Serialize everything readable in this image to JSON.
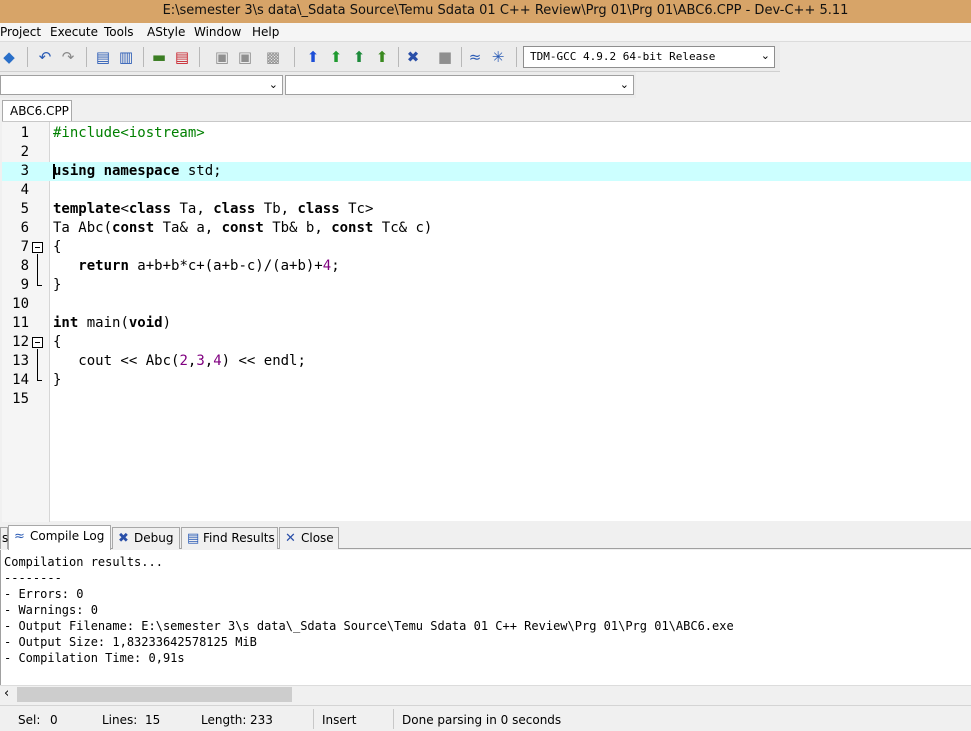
{
  "window": {
    "title": "E:\\semester 3\\s data\\_Sdata Source\\Temu Sdata 01 C++ Review\\Prg 01\\Prg 01\\ABC6.CPP - Dev-C++ 5.11"
  },
  "menu": [
    "Project",
    "Execute",
    "Tools",
    "AStyle",
    "Window",
    "Help"
  ],
  "toolbar": {
    "compiler": "TDM-GCC 4.9.2 64-bit Release",
    "icons": [
      "project-cube-icon",
      "undo-icon",
      "redo-icon",
      "bookmark-icon",
      "bookmark-goto-icon",
      "indent-icon",
      "unindent-icon",
      "add-to-project-icon",
      "remove-from-project-icon",
      "project-options-icon",
      "compile-icon",
      "run-icon",
      "compile-run-icon",
      "rebuild-icon",
      "debug-icon",
      "stop-icon",
      "syntax-check-icon",
      "profile-icon"
    ]
  },
  "editor": {
    "file_tab": "ABC6.CPP",
    "current_line": 3,
    "lines": [
      {
        "num": "1",
        "tokens": [
          {
            "t": "#include<iostream>",
            "c": "pp"
          }
        ]
      },
      {
        "num": "2",
        "tokens": []
      },
      {
        "num": "3",
        "tokens": [
          {
            "t": "using namespace",
            "c": "kw"
          },
          {
            "t": " std;",
            "c": ""
          }
        ]
      },
      {
        "num": "4",
        "tokens": []
      },
      {
        "num": "5",
        "tokens": [
          {
            "t": "template",
            "c": "kw"
          },
          {
            "t": "<",
            "c": ""
          },
          {
            "t": "class",
            "c": "kw"
          },
          {
            "t": " Ta, ",
            "c": ""
          },
          {
            "t": "class",
            "c": "kw"
          },
          {
            "t": " Tb, ",
            "c": ""
          },
          {
            "t": "class",
            "c": "kw"
          },
          {
            "t": " Tc>",
            "c": ""
          }
        ]
      },
      {
        "num": "6",
        "tokens": [
          {
            "t": "Ta Abc(",
            "c": ""
          },
          {
            "t": "const",
            "c": "kw"
          },
          {
            "t": " Ta& a, ",
            "c": ""
          },
          {
            "t": "const",
            "c": "kw"
          },
          {
            "t": " Tb& b, ",
            "c": ""
          },
          {
            "t": "const",
            "c": "kw"
          },
          {
            "t": " Tc& c)",
            "c": ""
          }
        ]
      },
      {
        "num": "7",
        "tokens": [
          {
            "t": "{",
            "c": ""
          }
        ]
      },
      {
        "num": "8",
        "tokens": [
          {
            "t": "   ",
            "c": ""
          },
          {
            "t": "return",
            "c": "kw"
          },
          {
            "t": " a+b+b*c+(a+b-c)/(a+b)+",
            "c": ""
          },
          {
            "t": "4",
            "c": "nm"
          },
          {
            "t": ";",
            "c": ""
          }
        ]
      },
      {
        "num": "9",
        "tokens": [
          {
            "t": "}",
            "c": ""
          }
        ]
      },
      {
        "num": "10",
        "tokens": []
      },
      {
        "num": "11",
        "tokens": [
          {
            "t": "int",
            "c": "kw"
          },
          {
            "t": " main(",
            "c": ""
          },
          {
            "t": "void",
            "c": "kw"
          },
          {
            "t": ")",
            "c": ""
          }
        ]
      },
      {
        "num": "12",
        "tokens": [
          {
            "t": "{",
            "c": ""
          }
        ]
      },
      {
        "num": "13",
        "tokens": [
          {
            "t": "   cout << Abc(",
            "c": ""
          },
          {
            "t": "2",
            "c": "nm"
          },
          {
            "t": ",",
            "c": ""
          },
          {
            "t": "3",
            "c": "nm"
          },
          {
            "t": ",",
            "c": ""
          },
          {
            "t": "4",
            "c": "nm"
          },
          {
            "t": ") << endl;",
            "c": ""
          }
        ]
      },
      {
        "num": "14",
        "tokens": [
          {
            "t": "}",
            "c": ""
          }
        ]
      },
      {
        "num": "15",
        "tokens": []
      }
    ]
  },
  "bottom_tabs": {
    "partial": "s",
    "compile_log": "Compile Log",
    "debug": "Debug",
    "find_results": "Find Results",
    "close": "Close"
  },
  "log": [
    "Compilation results...",
    "--------",
    "- Errors: 0",
    "- Warnings: 0",
    "- Output Filename: E:\\semester 3\\s data\\_Sdata Source\\Temu Sdata 01 C++ Review\\Prg 01\\Prg 01\\ABC6.exe",
    "- Output Size: 1,83233642578125 MiB",
    "- Compilation Time: 0,91s"
  ],
  "status": {
    "sel_label": "Sel:",
    "sel_value": "0",
    "lines_label": "Lines:",
    "lines_value": "15",
    "length_label": "Length:",
    "length_value": "233",
    "mode": "Insert",
    "message": "Done parsing in 0 seconds"
  },
  "colors": {
    "titlebar": "#d7a468",
    "current_line": "#ccffff",
    "preprocessor": "#008000",
    "number": "#800080"
  }
}
